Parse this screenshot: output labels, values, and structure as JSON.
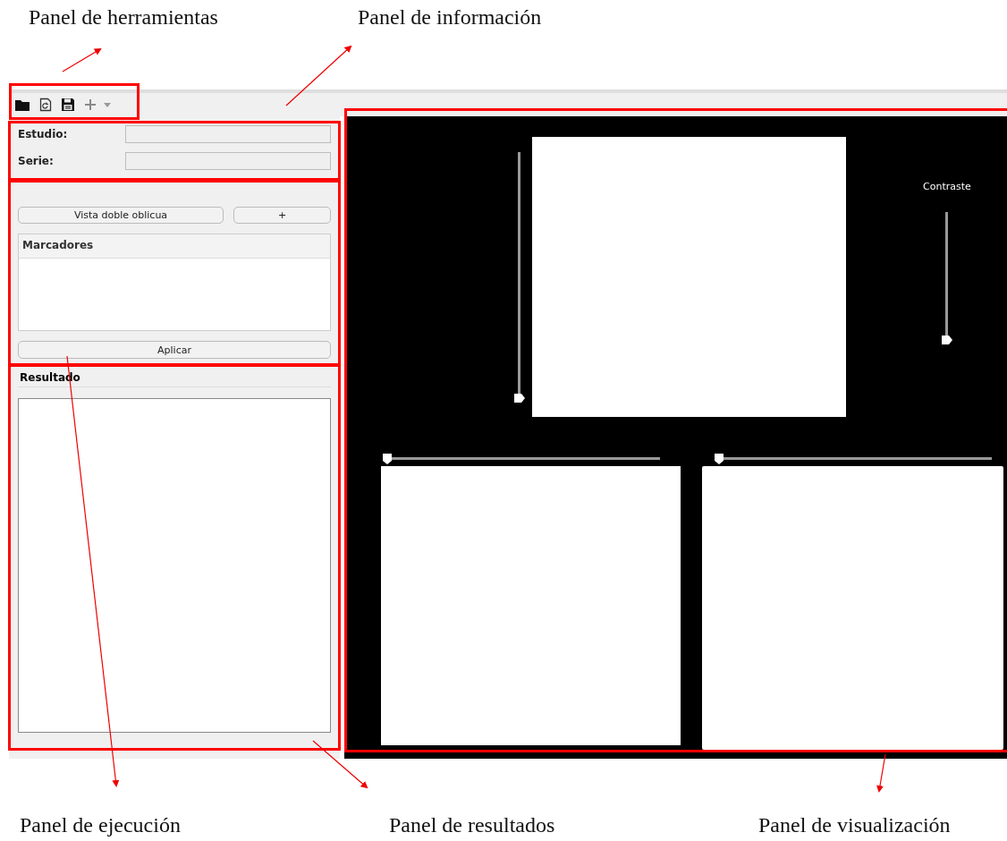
{
  "top_annotations": [
    {
      "label": "Panel de herramientas"
    },
    {
      "label": "Panel de información"
    }
  ],
  "bottom_annotations": [
    {
      "label": "Panel de ejecución"
    },
    {
      "label": "Panel de resultados"
    },
    {
      "label": "Panel de visualización"
    }
  ],
  "info": {
    "fields": [
      {
        "label": "Estudio:"
      },
      {
        "label": "Serie:"
      }
    ]
  },
  "execution": {
    "buttons": [
      "Vista doble oblicua",
      "+"
    ],
    "list_header": "Marcadores",
    "apply": "Aplicar"
  },
  "results": {
    "title": "Resultado"
  },
  "viewer": {
    "main_slider": {
      "level": 0
    },
    "contrast": {
      "label": "Contraste",
      "level": 0
    },
    "lower_views": [
      {
        "slider": {
          "level": 0
        }
      },
      {
        "slider": {
          "level": 0
        }
      }
    ]
  }
}
